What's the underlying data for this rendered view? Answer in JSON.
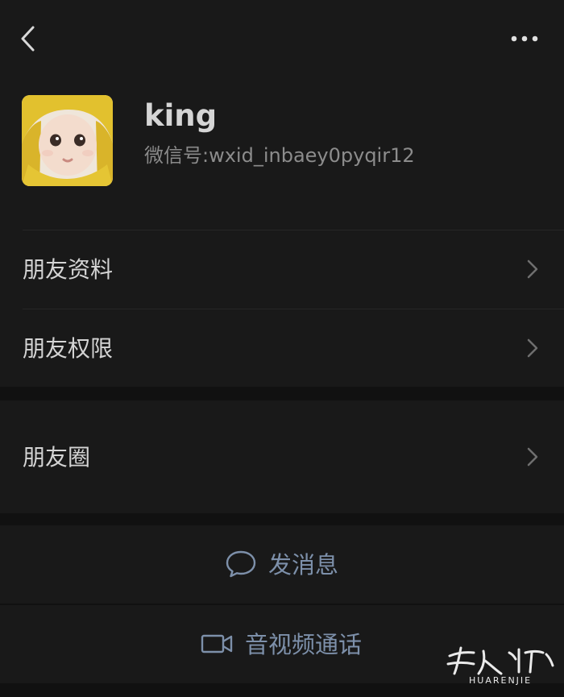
{
  "header": {
    "back_icon": "chevron-left-icon",
    "more_icon": "more-dots-icon"
  },
  "profile": {
    "name": "king",
    "wechat_id_label": "微信号:",
    "wechat_id_value": "wxid_inbaey0pyqir12"
  },
  "menu": [
    {
      "label": "朋友资料"
    },
    {
      "label": "朋友权限"
    },
    {
      "label": "朋友圈"
    }
  ],
  "actions": {
    "message": {
      "label": "发消息",
      "icon": "chat-bubble-icon"
    },
    "call": {
      "label": "音视频通话",
      "icon": "video-camera-icon"
    }
  },
  "watermark": {
    "text": "HUARENJIE"
  },
  "colors": {
    "background": "#111111",
    "panel": "#191919",
    "text": "#d4d4d4",
    "muted": "#8a8a8a",
    "link": "#7d90aa"
  }
}
